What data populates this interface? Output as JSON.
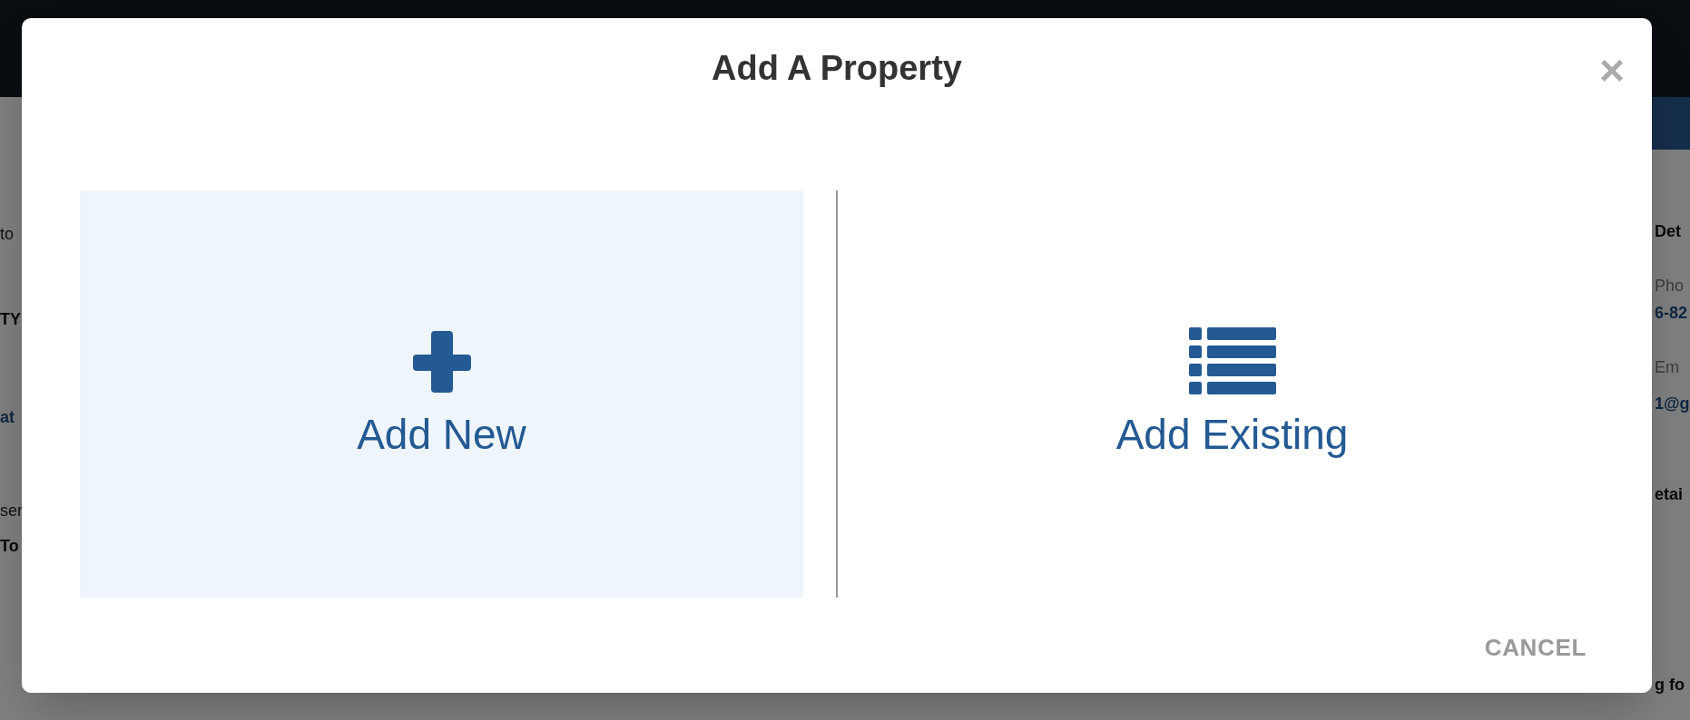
{
  "background": {
    "left_fragments": [
      {
        "text": "to",
        "kind": "plain"
      },
      {
        "text": "TY",
        "kind": "bold"
      },
      {
        "text": "at",
        "kind": "link"
      },
      {
        "text": "ser",
        "kind": "plain"
      },
      {
        "text": "To",
        "kind": "bold"
      }
    ],
    "right_fragments": [
      {
        "text": "Det",
        "kind": "bold"
      },
      {
        "text": "Pho",
        "kind": "muted"
      },
      {
        "text": "6-82",
        "kind": "link"
      },
      {
        "text": "Em",
        "kind": "muted"
      },
      {
        "text": "1@g",
        "kind": "link"
      },
      {
        "text": "etai",
        "kind": "bold"
      },
      {
        "text": "g fo",
        "kind": "bold"
      }
    ]
  },
  "dialog": {
    "title": "Add A Property",
    "close": "×",
    "options": [
      {
        "label": "Add New",
        "kind": "new",
        "selected": true
      },
      {
        "label": "Add Existing",
        "kind": "existing",
        "selected": false
      }
    ],
    "cancel": "CANCEL"
  }
}
